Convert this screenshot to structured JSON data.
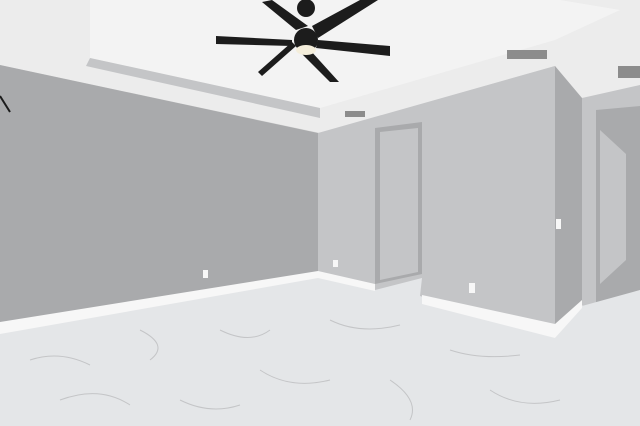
{
  "scene": {
    "subject": "empty-room-interior",
    "colors": {
      "wall": "#a9aaac",
      "wall_light": "#c4c5c7",
      "ceiling": "#ececec",
      "tray_ceiling": "#f3f3f3",
      "floor": "#e4e6e8",
      "baseboard": "#f7f7f7",
      "fan": "#1c1c1c",
      "fan_light": "#f4eedb",
      "vent": "#8c8c8c"
    },
    "icons": [
      "ceiling-fan-icon",
      "air-vent-icon",
      "wall-outlet-icon",
      "light-switch-icon"
    ]
  }
}
